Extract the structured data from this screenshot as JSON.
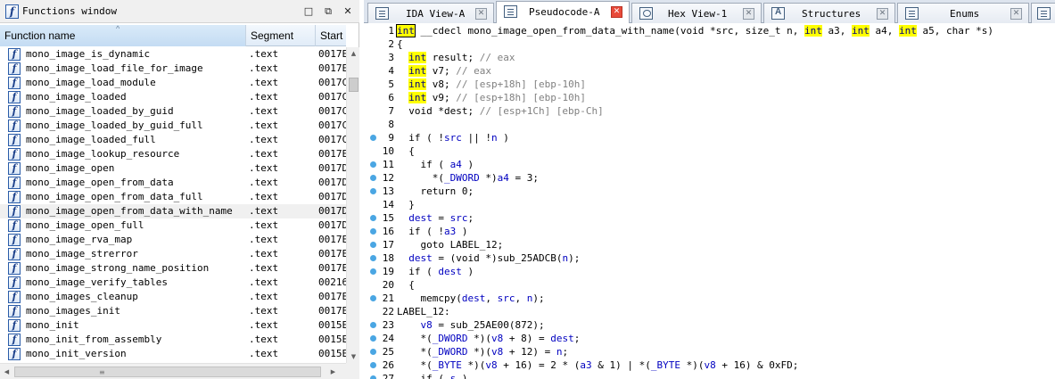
{
  "functions_window": {
    "title": "Functions window",
    "columns": [
      "Function name",
      "Segment",
      "Start"
    ],
    "sorted_column": "Function name",
    "rows": [
      {
        "name": "mono_image_is_dynamic",
        "segment": ".text",
        "start": "0017E"
      },
      {
        "name": "mono_image_load_file_for_image",
        "segment": ".text",
        "start": "0017E"
      },
      {
        "name": "mono_image_load_module",
        "segment": ".text",
        "start": "0017C"
      },
      {
        "name": "mono_image_loaded",
        "segment": ".text",
        "start": "0017C"
      },
      {
        "name": "mono_image_loaded_by_guid",
        "segment": ".text",
        "start": "0017C"
      },
      {
        "name": "mono_image_loaded_by_guid_full",
        "segment": ".text",
        "start": "0017C"
      },
      {
        "name": "mono_image_loaded_full",
        "segment": ".text",
        "start": "0017C"
      },
      {
        "name": "mono_image_lookup_resource",
        "segment": ".text",
        "start": "0017E"
      },
      {
        "name": "mono_image_open",
        "segment": ".text",
        "start": "0017D"
      },
      {
        "name": "mono_image_open_from_data",
        "segment": ".text",
        "start": "0017D"
      },
      {
        "name": "mono_image_open_from_data_full",
        "segment": ".text",
        "start": "0017D"
      },
      {
        "name": "mono_image_open_from_data_with_name",
        "segment": ".text",
        "start": "0017D"
      },
      {
        "name": "mono_image_open_full",
        "segment": ".text",
        "start": "0017D"
      },
      {
        "name": "mono_image_rva_map",
        "segment": ".text",
        "start": "0017E"
      },
      {
        "name": "mono_image_strerror",
        "segment": ".text",
        "start": "0017E"
      },
      {
        "name": "mono_image_strong_name_position",
        "segment": ".text",
        "start": "0017E"
      },
      {
        "name": "mono_image_verify_tables",
        "segment": ".text",
        "start": "00216"
      },
      {
        "name": "mono_images_cleanup",
        "segment": ".text",
        "start": "0017E"
      },
      {
        "name": "mono_images_init",
        "segment": ".text",
        "start": "0017E"
      },
      {
        "name": "mono_init",
        "segment": ".text",
        "start": "0015E"
      },
      {
        "name": "mono_init_from_assembly",
        "segment": ".text",
        "start": "0015E"
      },
      {
        "name": "mono_init_version",
        "segment": ".text",
        "start": "0015E"
      }
    ],
    "selected_index": 11
  },
  "tabs": [
    {
      "label": "IDA View-A",
      "icon": "ida-view-icon",
      "active": false
    },
    {
      "label": "Pseudocode-A",
      "icon": "pseudocode-icon",
      "active": true
    },
    {
      "label": "Hex View-1",
      "icon": "hex-view-icon",
      "active": false
    },
    {
      "label": "Structures",
      "icon": "structures-icon",
      "active": false
    },
    {
      "label": "Enums",
      "icon": "enums-icon",
      "active": false
    }
  ],
  "pseudocode": {
    "lines": [
      {
        "n": "1",
        "bp": false,
        "html": "<span class=\"k cursor\">int</span> __cdecl mono_image_open_from_data_with_name(void *src, size_t n, <span class=\"k\">int</span> a3, <span class=\"k\">int</span> a4, <span class=\"k\">int</span> a5, char *s)"
      },
      {
        "n": "2",
        "bp": false,
        "html": "{"
      },
      {
        "n": "3",
        "bp": false,
        "html": "  <span class=\"k\">int</span> result; <span class=\"c\">// eax</span>"
      },
      {
        "n": "4",
        "bp": false,
        "html": "  <span class=\"k\">int</span> v7; <span class=\"c\">// eax</span>"
      },
      {
        "n": "5",
        "bp": false,
        "html": "  <span class=\"k\">int</span> v8; <span class=\"c\">// [esp+18h] [ebp-10h]</span>"
      },
      {
        "n": "6",
        "bp": false,
        "html": "  <span class=\"k\">int</span> v9; <span class=\"c\">// [esp+18h] [ebp-10h]</span>"
      },
      {
        "n": "7",
        "bp": false,
        "html": "  void *dest; <span class=\"c\">// [esp+1Ch] [ebp-Ch]</span>"
      },
      {
        "n": "8",
        "bp": false,
        "html": ""
      },
      {
        "n": "9",
        "bp": true,
        "html": "  if ( !<span class=\"var\">src</span> || !<span class=\"var\">n</span> )"
      },
      {
        "n": "10",
        "bp": false,
        "html": "  {"
      },
      {
        "n": "11",
        "bp": true,
        "html": "    if ( <span class=\"var\">a4</span> )"
      },
      {
        "n": "12",
        "bp": true,
        "html": "      *(<span class=\"var\">_DWORD</span> *)<span class=\"var\">a4</span> = 3;"
      },
      {
        "n": "13",
        "bp": true,
        "html": "    return 0;"
      },
      {
        "n": "14",
        "bp": false,
        "html": "  }"
      },
      {
        "n": "15",
        "bp": true,
        "html": "  <span class=\"var\">dest</span> = <span class=\"var\">src</span>;"
      },
      {
        "n": "16",
        "bp": true,
        "html": "  if ( !<span class=\"var\">a3</span> )"
      },
      {
        "n": "17",
        "bp": true,
        "html": "    goto LABEL_12;"
      },
      {
        "n": "18",
        "bp": true,
        "html": "  <span class=\"var\">dest</span> = (void *)sub_25ADCB(<span class=\"var\">n</span>);"
      },
      {
        "n": "19",
        "bp": true,
        "html": "  if ( <span class=\"var\">dest</span> )"
      },
      {
        "n": "20",
        "bp": false,
        "html": "  {"
      },
      {
        "n": "21",
        "bp": true,
        "html": "    memcpy(<span class=\"var\">dest</span>, <span class=\"var\">src</span>, <span class=\"var\">n</span>);"
      },
      {
        "n": "22",
        "bp": false,
        "html": "LABEL_12:"
      },
      {
        "n": "23",
        "bp": true,
        "html": "    <span class=\"var\">v8</span> = sub_25AE00(872);"
      },
      {
        "n": "24",
        "bp": true,
        "html": "    *(<span class=\"var\">_DWORD</span> *)(<span class=\"var\">v8</span> + 8) = <span class=\"var\">dest</span>;"
      },
      {
        "n": "25",
        "bp": true,
        "html": "    *(<span class=\"var\">_DWORD</span> *)(<span class=\"var\">v8</span> + 12) = <span class=\"var\">n</span>;"
      },
      {
        "n": "26",
        "bp": true,
        "html": "    *(<span class=\"var\">_BYTE</span> *)(<span class=\"var\">v8</span> + 16) = 2 * (<span class=\"var\">a3</span> &amp; 1) | *(<span class=\"var\">_BYTE</span> *)(<span class=\"var\">v8</span> + 16) &amp; 0xFD;"
      },
      {
        "n": "27",
        "bp": true,
        "html": "    if ( <span class=\"var\">s</span> )"
      }
    ]
  },
  "colors": {
    "keyword_highlight": "#ffff00",
    "breakpoint_dot": "#4aa6e3",
    "comment": "#808080",
    "active_tab_close": "#e84a3a"
  }
}
